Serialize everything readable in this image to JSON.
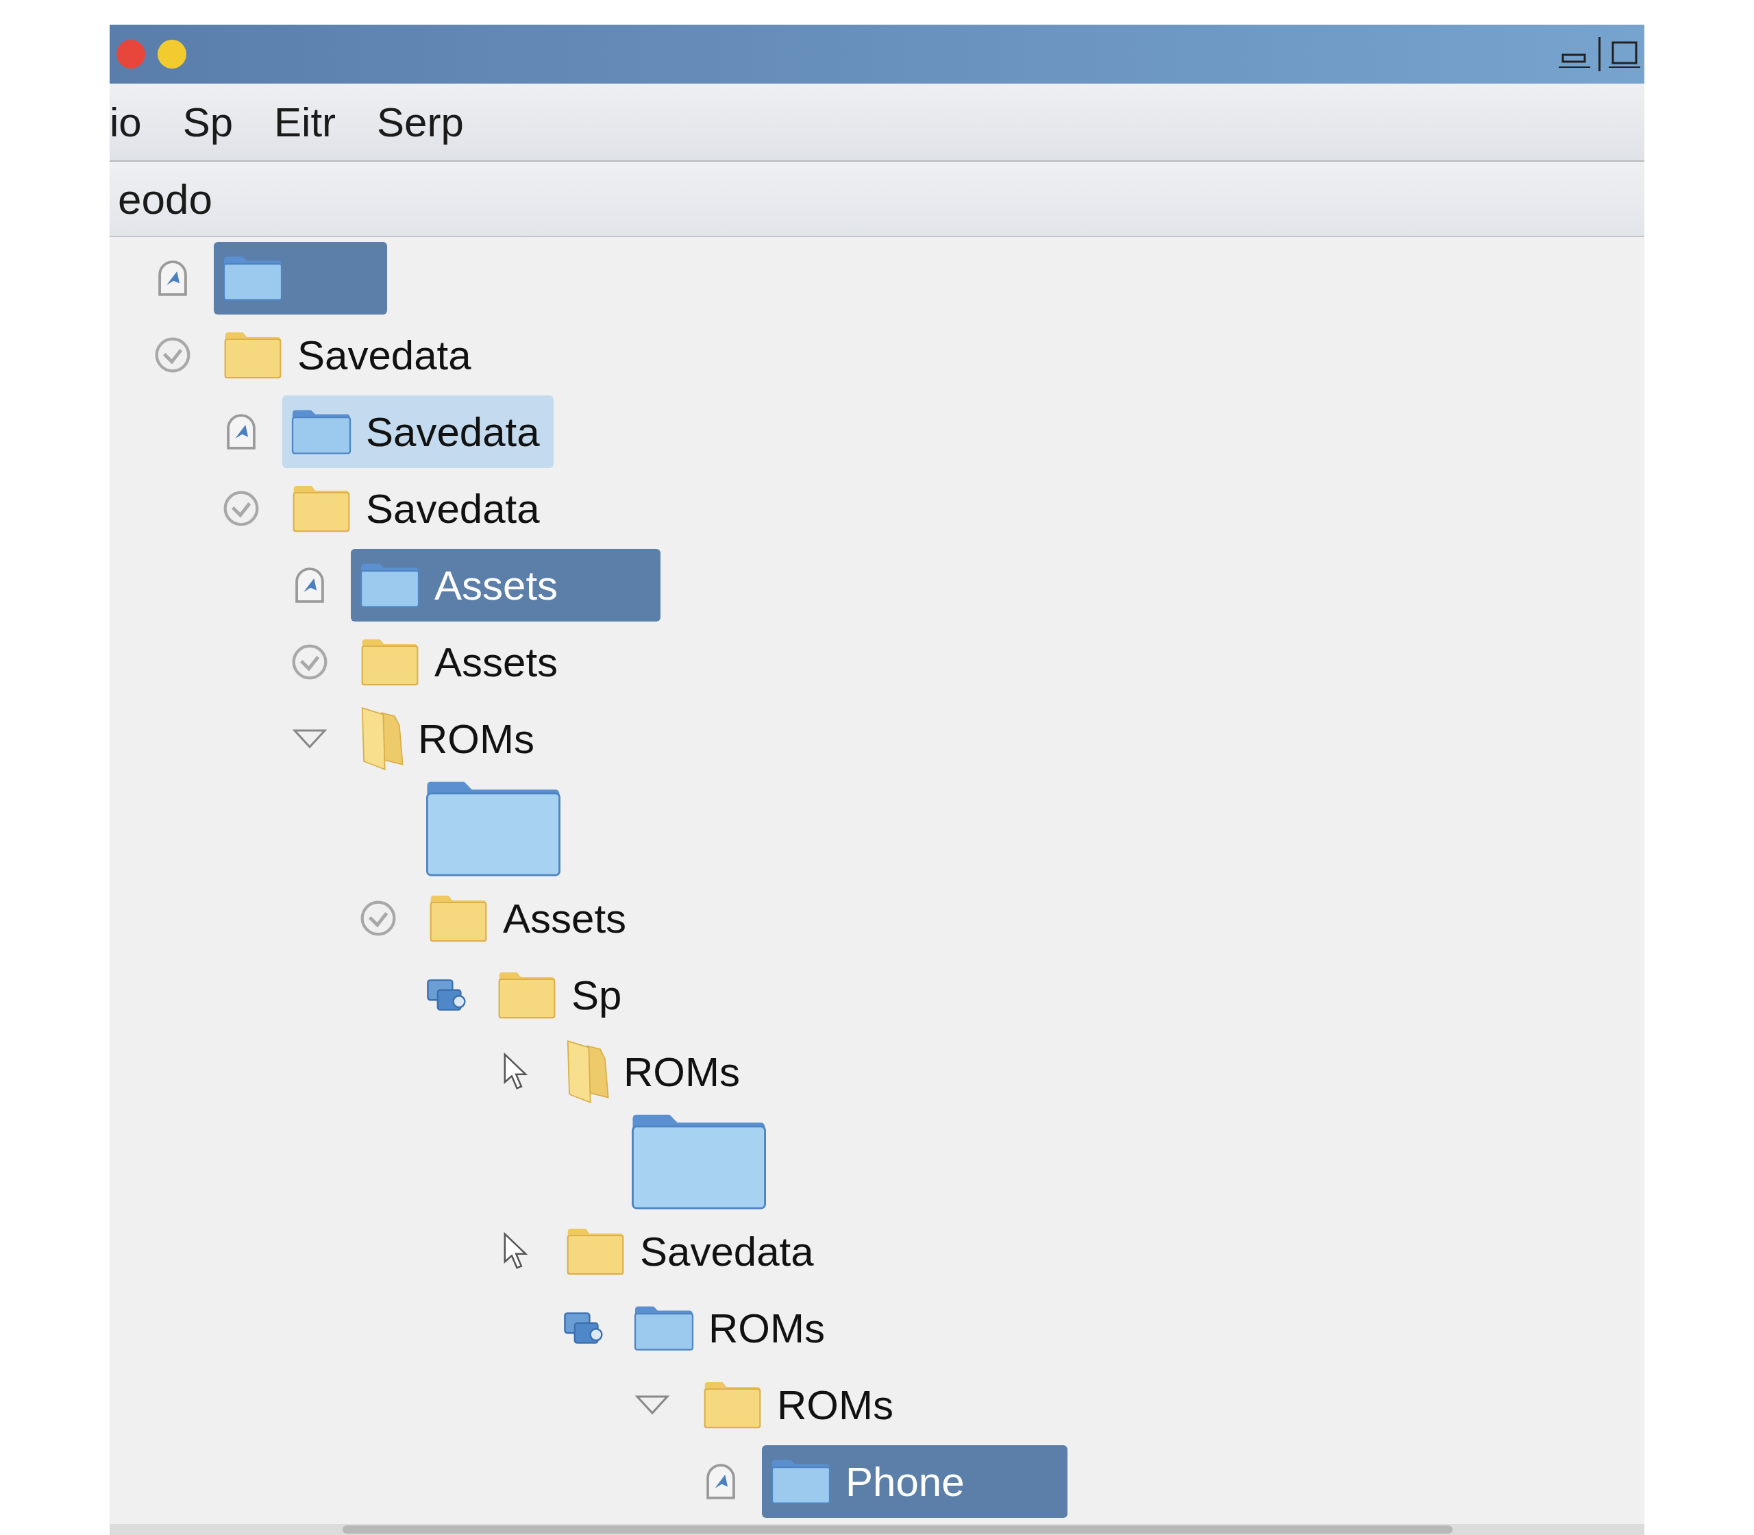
{
  "window": {
    "controls": [
      {
        "kind": "close"
      },
      {
        "kind": "minimize"
      }
    ]
  },
  "menu_bar": {
    "items": [
      "io",
      "Sp",
      "Eitr",
      "Serp"
    ]
  },
  "toolbar": {
    "label": "eodo"
  },
  "tree": [
    {
      "toggle": {
        "kind": "pin"
      },
      "folder": {
        "kind": "blue"
      },
      "selected": true,
      "hovered": false
    },
    {
      "toggle": {
        "kind": "check"
      },
      "folder": {
        "kind": "yellow"
      },
      "label": "Savedata",
      "selected": false,
      "hovered": false,
      "children": [
        {
          "toggle": {
            "kind": "pin"
          },
          "folder": {
            "kind": "blue"
          },
          "label": "Savedata",
          "selected": false,
          "hovered": true
        },
        {
          "toggle": {
            "kind": "check"
          },
          "folder": {
            "kind": "yellow"
          },
          "label": "Savedata",
          "selected": false,
          "hovered": false,
          "children": [
            {
              "toggle": {
                "kind": "pin"
              },
              "folder": {
                "kind": "blue"
              },
              "label": "Assets",
              "selected": true,
              "hovered": false
            },
            {
              "toggle": {
                "kind": "check"
              },
              "folder": {
                "kind": "yellow"
              },
              "label": "Assets",
              "selected": false,
              "hovered": false
            },
            {
              "toggle": {
                "kind": "triangle"
              },
              "folder": {
                "kind": "open"
              },
              "label": "ROMs",
              "selected": false,
              "hovered": false,
              "children": [
                {
                  "folder": {
                    "kind": "large"
                  },
                  "selected": false,
                  "hovered": false
                },
                {
                  "toggle": {
                    "kind": "check"
                  },
                  "folder": {
                    "kind": "yellow"
                  },
                  "label": "Assets",
                  "selected": false,
                  "hovered": false,
                  "children": [
                    {
                      "toggle": {
                        "kind": "app"
                      },
                      "folder": {
                        "kind": "yellow"
                      },
                      "label": "Sp",
                      "selected": false,
                      "hovered": false,
                      "children": [
                        {
                          "toggle": {
                            "kind": "cursor"
                          },
                          "folder": {
                            "kind": "open"
                          },
                          "label": "ROMs",
                          "selected": false,
                          "hovered": false,
                          "children": [
                            {
                              "folder": {
                                "kind": "large"
                              },
                              "selected": false,
                              "hovered": false
                            }
                          ]
                        },
                        {
                          "toggle": {
                            "kind": "cursor"
                          },
                          "folder": {
                            "kind": "yellow"
                          },
                          "label": "Savedata",
                          "selected": false,
                          "hovered": false,
                          "children": [
                            {
                              "toggle": {
                                "kind": "app"
                              },
                              "folder": {
                                "kind": "blue"
                              },
                              "label": "ROMs",
                              "selected": false,
                              "hovered": false,
                              "children": [
                                {
                                  "toggle": {
                                    "kind": "triangle"
                                  },
                                  "folder": {
                                    "kind": "yellow"
                                  },
                                  "label": "ROMs",
                                  "selected": false,
                                  "hovered": false,
                                  "children": [
                                    {
                                      "toggle": {
                                        "kind": "pin"
                                      },
                                      "folder": {
                                        "kind": "blue"
                                      },
                                      "label": "Phone",
                                      "selected": true,
                                      "hovered": false
                                    }
                                  ]
                                }
                              ]
                            }
                          ]
                        }
                      ]
                    }
                  ]
                }
              ]
            }
          ]
        }
      ]
    }
  ]
}
